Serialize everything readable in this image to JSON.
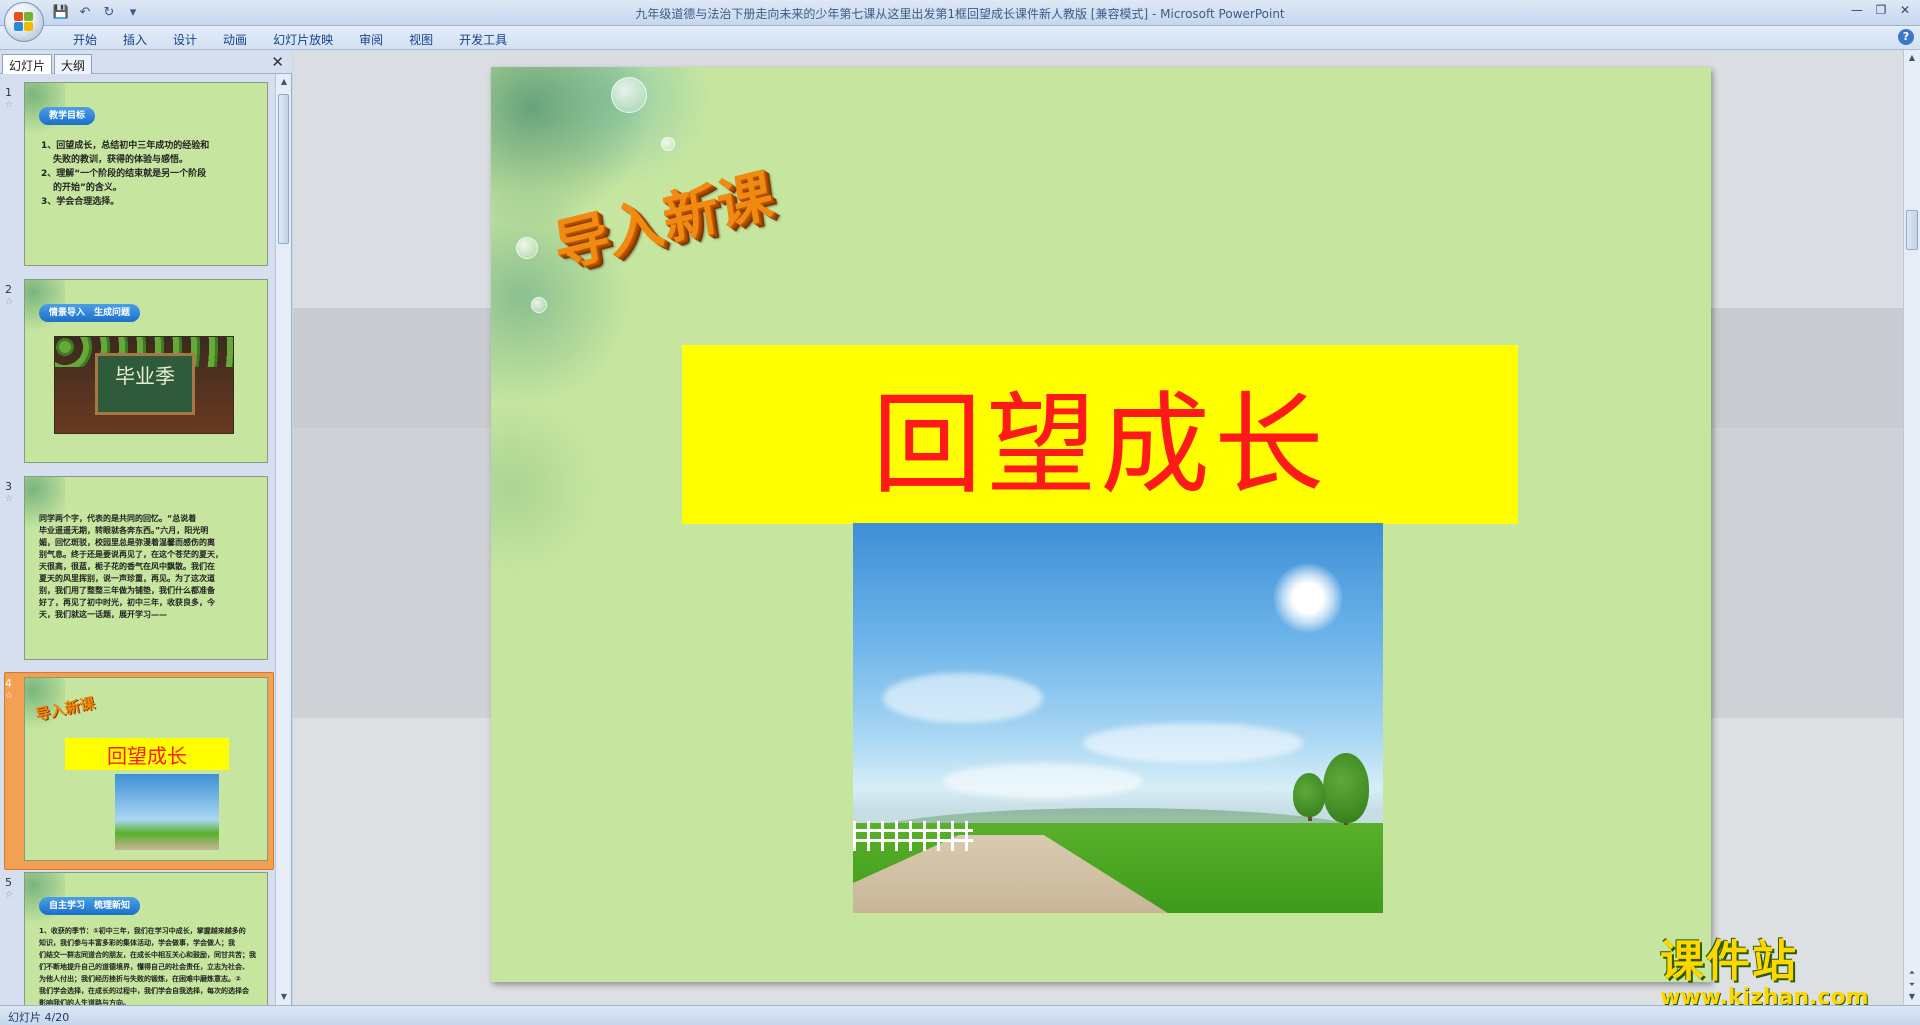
{
  "window": {
    "title": "九年级道德与法治下册走向未来的少年第七课从这里出发第1框回望成长课件新人教版 [兼容模式] - Microsoft PowerPoint",
    "controls": [
      "minimize",
      "restore",
      "close"
    ]
  },
  "qat": {
    "icons": [
      "save-icon",
      "undo-icon",
      "redo-icon",
      "customize-icon"
    ]
  },
  "ribbon": {
    "tabs": [
      "开始",
      "插入",
      "设计",
      "动画",
      "幻灯片放映",
      "审阅",
      "视图",
      "开发工具"
    ],
    "help": "?"
  },
  "left_pane": {
    "tabs": [
      "幻灯片",
      "大纲"
    ],
    "close": "✕",
    "slides": [
      {
        "num": "1",
        "pill": "教学目标",
        "lines": [
          "1、回望成长，总结初中三年成功的经验和",
          "失败的教训，获得的体验与感悟。",
          "2、理解“一个阶段的结束就是另一个阶段",
          "的开始”的含义。",
          "3、学会合理选择。"
        ]
      },
      {
        "num": "2",
        "pill": "情景导入　生成问题",
        "board_text": "毕业季"
      },
      {
        "num": "3",
        "lines": [
          "同学两个字，代表的是共同的回忆。“总说着",
          "毕业遥遥无期，转眼就各奔东西。”六月，阳光明",
          "媚，回忆斑驳，校园里总是弥漫着温馨而感伤的离",
          "别气息。终于还是要说再见了，在这个苍茫的夏天，",
          "天很高，很蓝，栀子花的香气在风中飘散。我们在",
          "夏天的风里挥别，说一声珍重，再见。为了这次道",
          "别，我们用了整整三年做为铺垫，我们什么都准备",
          "好了，再见了初中时光，初中三年，收获良多，今",
          "天，我们就这一话题，展开学习——"
        ]
      },
      {
        "num": "4",
        "word": "导入新课",
        "title": "回望成长"
      },
      {
        "num": "5",
        "pill": "自主学习　梳理新知",
        "lines": [
          "1、收获的季节：①初中三年，我们在学习中成长，掌握越来越多的",
          "知识，我们参与丰富多彩的集体活动，学会做事，学会做人；我",
          "们结交一群志同道合的朋友，在成长中相互关心和鼓励，同甘共苦；我",
          "们不断地提升自己的道德境界，懂得自己的社会责任，立志为社会、",
          "为他人付出；我们经历挫折与失败的锻炼，在困难中磨炼意志。②",
          "我们学会选择，在成长的过程中，我们学会自我选择，每次的选择会",
          "影响我们的人生道路与方向。"
        ]
      }
    ]
  },
  "slide": {
    "wordart": "导入新课",
    "title": "回望成长",
    "colors": {
      "background": "#c6e6a0",
      "title_box": "#ffff00",
      "title_text": "#ff1a1a",
      "wordart": "#f08a10"
    }
  },
  "watermark": {
    "brand": "课件站",
    "url": "www.kjzhan.com"
  },
  "status": {
    "slide_counter": "幻灯片 4/20"
  }
}
